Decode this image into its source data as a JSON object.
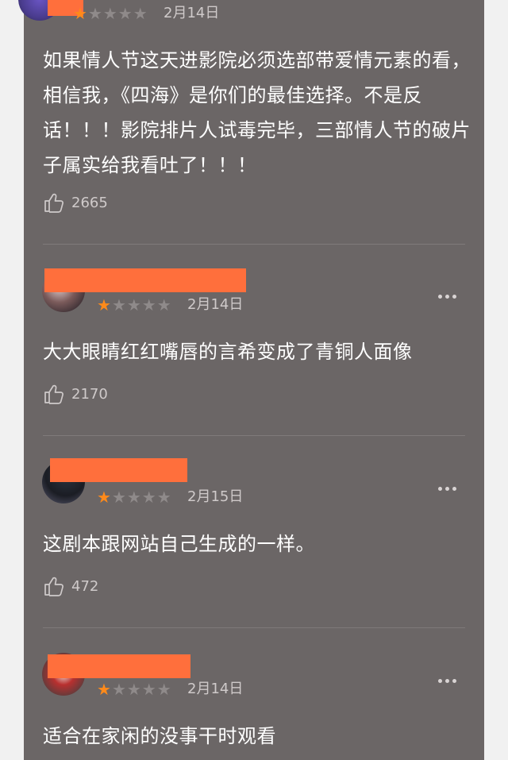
{
  "reviews": [
    {
      "date": "2月14日",
      "rating": 1,
      "text": "如果情人节这天进影院必须选部带爱情元素的看，相信我，《四海》是你们的最佳选择。不是反话！！！影院排片人试毒完毕，三部情人节的破片子属实给我看吐了！！！",
      "likes": "2665"
    },
    {
      "date": "2月14日",
      "rating": 1,
      "text": "大大眼睛红红嘴唇的言希变成了青铜人面像",
      "likes": "2170"
    },
    {
      "date": "2月15日",
      "rating": 1,
      "text": "这剧本跟网站自己生成的一样。",
      "likes": "472"
    },
    {
      "date": "2月14日",
      "rating": 1,
      "text": "适合在家闲的没事干时观看",
      "likes": ""
    }
  ],
  "colors": {
    "card_bg": "#6b6666",
    "redaction": "#ff6f3c",
    "star_on": "#ff8a1a",
    "star_off": "#8f8a8a"
  },
  "icons": {
    "like": "thumbs-up-icon",
    "more": "more-dots-icon",
    "star": "star-icon"
  }
}
